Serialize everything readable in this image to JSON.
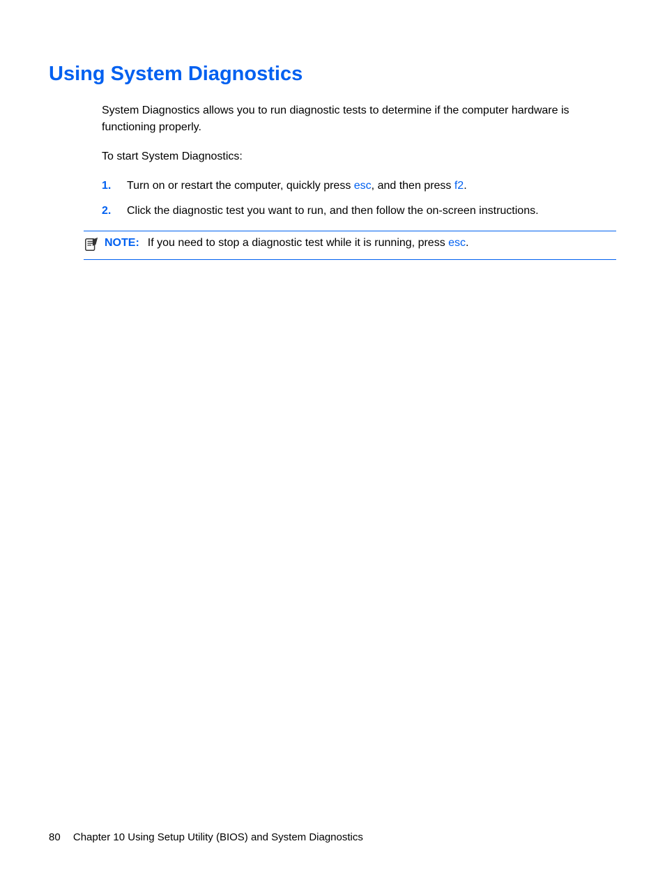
{
  "heading": "Using System Diagnostics",
  "intro": "System Diagnostics allows you to run diagnostic tests to determine if the computer hardware is functioning properly.",
  "start_text": "To start System Diagnostics:",
  "steps": [
    {
      "number": "1.",
      "before": "Turn on or restart the computer, quickly press ",
      "key1": "esc",
      "middle": ", and then press ",
      "key2": "f2",
      "after": "."
    },
    {
      "number": "2.",
      "text": "Click the diagnostic test you want to run, and then follow the on-screen instructions."
    }
  ],
  "note": {
    "label": "NOTE:",
    "before": "If you need to stop a diagnostic test while it is running, press ",
    "key": "esc",
    "after": "."
  },
  "footer": {
    "page": "80",
    "chapter": "Chapter 10   Using Setup Utility (BIOS) and System Diagnostics"
  }
}
